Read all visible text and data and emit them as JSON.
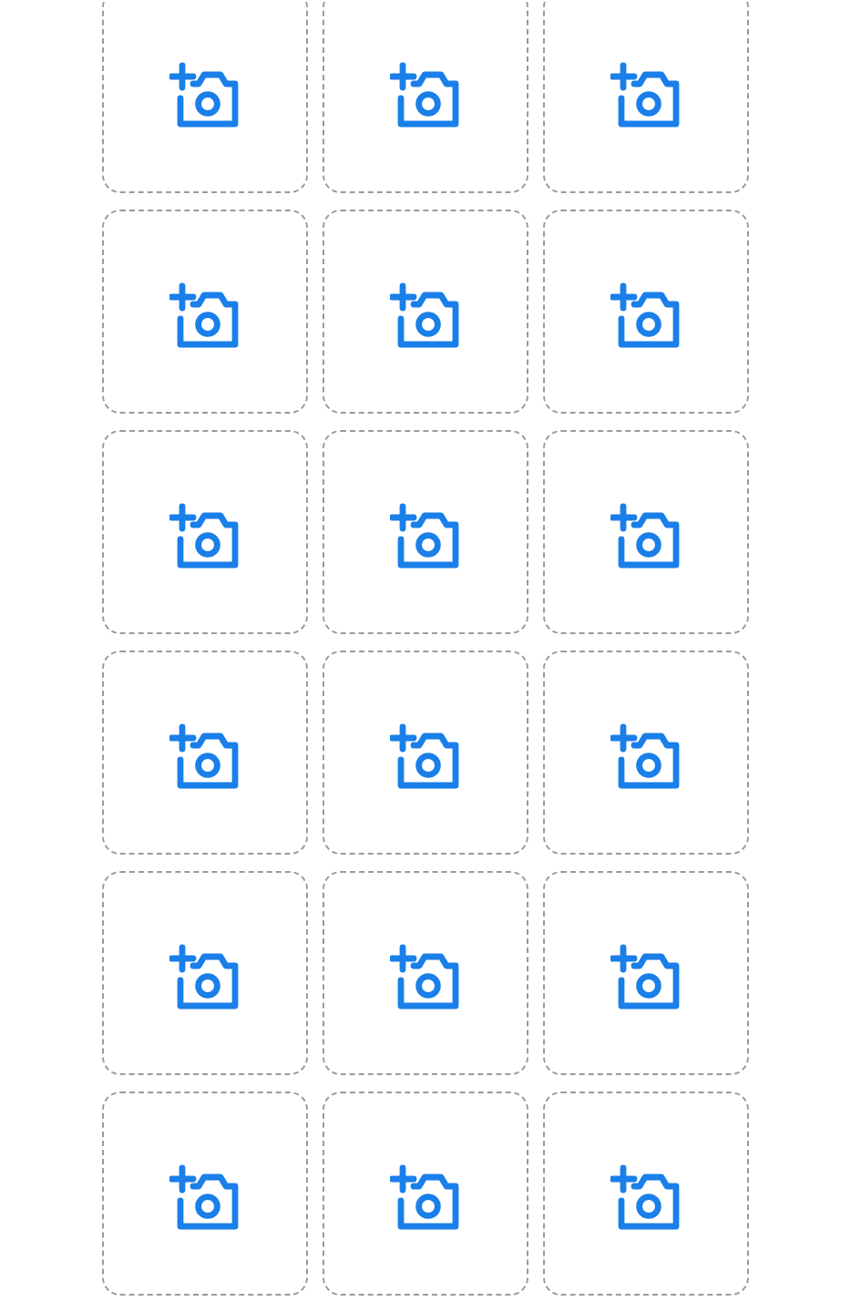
{
  "tiles": [
    {
      "kind": "add-photo"
    },
    {
      "kind": "add-photo"
    },
    {
      "kind": "add-photo"
    },
    {
      "kind": "add-photo"
    },
    {
      "kind": "add-photo"
    },
    {
      "kind": "add-photo"
    },
    {
      "kind": "add-photo"
    },
    {
      "kind": "add-photo"
    },
    {
      "kind": "add-photo"
    },
    {
      "kind": "add-photo"
    },
    {
      "kind": "add-photo"
    },
    {
      "kind": "add-photo"
    },
    {
      "kind": "add-photo"
    },
    {
      "kind": "add-photo"
    },
    {
      "kind": "add-photo"
    },
    {
      "kind": "add-photo"
    },
    {
      "kind": "add-photo"
    },
    {
      "kind": "add-photo"
    }
  ]
}
